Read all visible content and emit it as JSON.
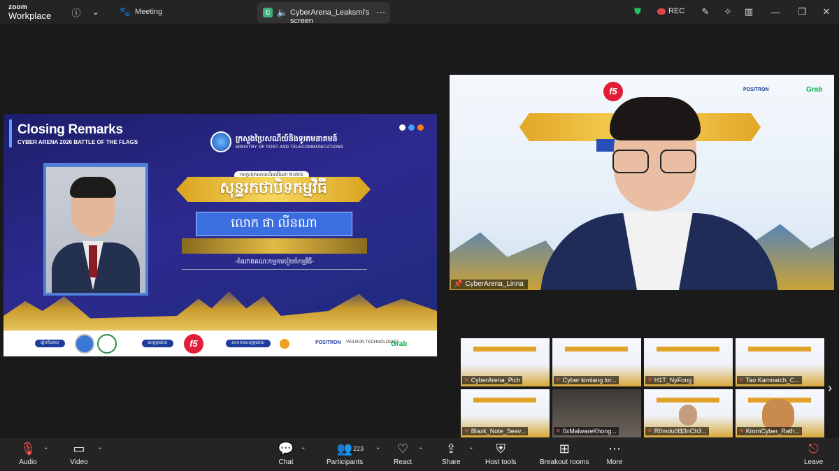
{
  "app": {
    "brand_line1": "zoom",
    "brand_line2": "Workplace",
    "meeting_label": "Meeting"
  },
  "share_tab": {
    "badge": "C",
    "title": "CyberArena_Leaksmi's screen"
  },
  "recording": {
    "label": "REC"
  },
  "slide": {
    "title": "Closing Remarks",
    "subtitle": "CYBER ARENA 2026  BATTLE OF THE FLAGS",
    "ministry_km": "ក្រសួងប្រៃសណីយ៍និងទូរគមនាគមន៍",
    "ministry_en": "MINISTRY OF POST AND TELECOMMUNICATIONS",
    "event_tag": "ការប្រកួតសាយប័រអារ៉ែណា ២០២៦",
    "banner": "សុន្ទរកថាបិទកម្មវិធី",
    "speaker_name": "លោក ផា លីនណា",
    "speaker_role": "-តំណាងគណៈកម្មការរៀបចំកម្មវិធី-",
    "footer": {
      "organizer": "រៀបចំដោយ",
      "sponsor1": "ឧបត្ថម្ភដោយ",
      "sponsor2": "សហការឧបត្ថម្ភដោយ",
      "f5": "f5",
      "positron": "POSITRON",
      "veilron": "VEILRON TECHNOLOGIES",
      "grab": "Grab"
    },
    "dot_colors": [
      "#ffffff",
      "#3aa3ff",
      "#ff7b1c"
    ]
  },
  "speaker_video": {
    "name": "CyberArena_Linna"
  },
  "gallery": [
    {
      "name": "CyberArena_Pich",
      "kind": "slide"
    },
    {
      "name": "Cyber kimlang lor...",
      "kind": "slide"
    },
    {
      "name": "H1T_NyFong",
      "kind": "slide"
    },
    {
      "name": "Tao Kamnarch_C...",
      "kind": "slide"
    },
    {
      "name": "Blaxk_Note_Seav...",
      "kind": "slide"
    },
    {
      "name": "0xMalwareKhong...",
      "kind": "room"
    },
    {
      "name": "R0mdu0l$3nCh3...",
      "kind": "person"
    },
    {
      "name": "KromCyber_Rath...",
      "kind": "avatar"
    }
  ],
  "toolbar": {
    "audio": "Audio",
    "video": "Video",
    "chat": "Chat",
    "participants": "Participants",
    "participants_count": "223",
    "react": "React",
    "share": "Share",
    "host_tools": "Host tools",
    "breakout": "Breakout rooms",
    "more": "More",
    "leave": "Leave"
  },
  "colors": {
    "accent_green": "#3bb07a",
    "rec_red": "#e0464b",
    "leave_red": "#ff4d4d",
    "shield_green": "#22c55e"
  }
}
